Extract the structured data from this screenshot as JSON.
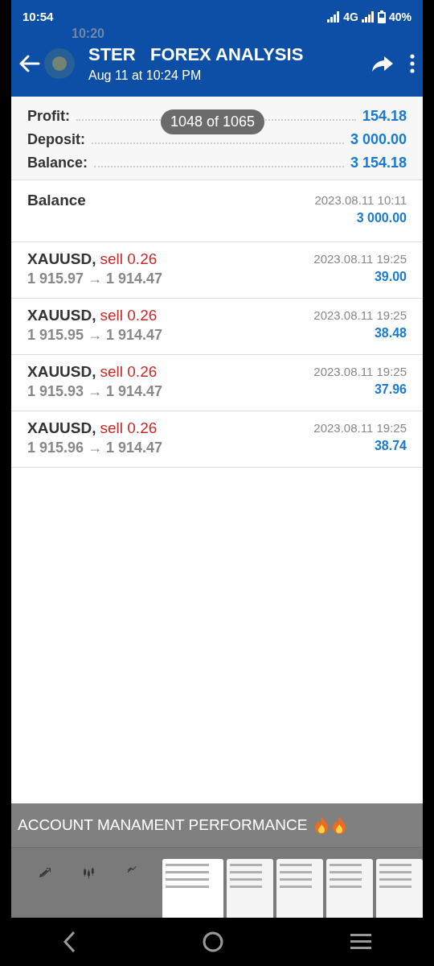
{
  "status_bar": {
    "time": "10:54",
    "network": "4G",
    "battery": "40%"
  },
  "ghost_status": {
    "time": "10:20"
  },
  "header": {
    "title": "STER   FOREX ANALYSIS",
    "subtitle": "Aug 11 at 10:24 PM"
  },
  "counter": "1048 of 1065",
  "summary": [
    {
      "label": "Profit:",
      "value": "154.18"
    },
    {
      "label": "Deposit:",
      "value": "3 000.00"
    },
    {
      "label": "Balance:",
      "value": "3 154.18"
    }
  ],
  "deals": [
    {
      "kind": "balance",
      "title": "Balance",
      "time": "2023.08.11 10:11",
      "amount": "3 000.00"
    },
    {
      "kind": "trade",
      "symbol": "XAUUSD,",
      "side": "sell 0.26",
      "prices": "1 915.97 → 1 914.47",
      "time": "2023.08.11 19:25",
      "amount": "39.00"
    },
    {
      "kind": "trade",
      "symbol": "XAUUSD,",
      "side": "sell 0.26",
      "prices": "1 915.95 → 1 914.47",
      "time": "2023.08.11 19:25",
      "amount": "38.48"
    },
    {
      "kind": "trade",
      "symbol": "XAUUSD,",
      "side": "sell 0.26",
      "prices": "1 915.93 → 1 914.47",
      "time": "2023.08.11 19:25",
      "amount": "37.96"
    },
    {
      "kind": "trade",
      "symbol": "XAUUSD,",
      "side": "sell 0.26",
      "prices": "1 915.96 → 1 914.47",
      "time": "2023.08.11 19:25",
      "amount": "38.74"
    }
  ],
  "caption": "ACCOUNT MANAMENT PERFORMANCE",
  "thumbnails": [
    {
      "selected": true
    },
    {
      "selected": false
    },
    {
      "selected": false
    },
    {
      "selected": false
    },
    {
      "selected": false
    }
  ]
}
